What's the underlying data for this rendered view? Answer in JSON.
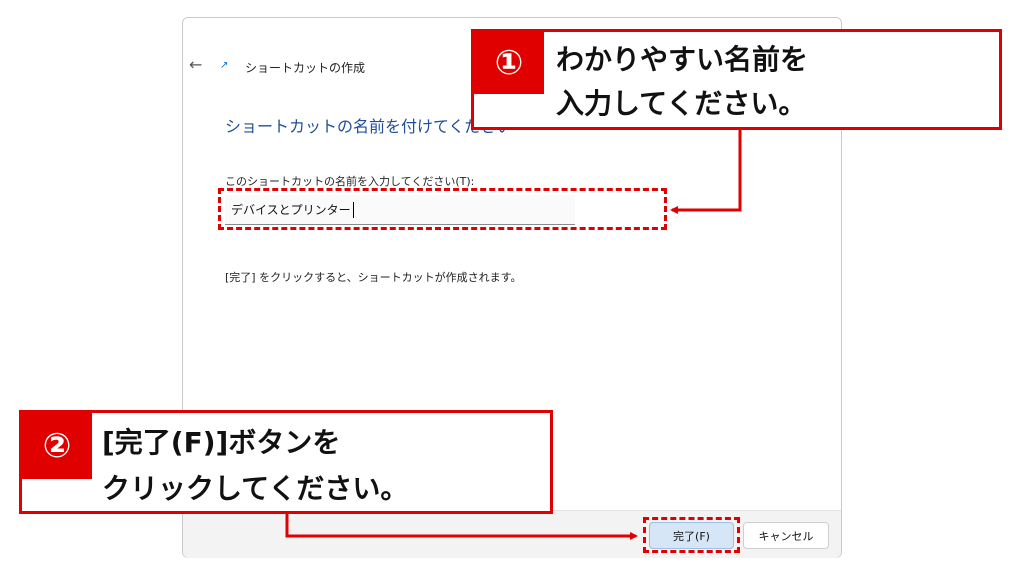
{
  "wizard": {
    "back_icon": "back-arrow-icon",
    "shortcut_icon": "shortcut-arrow-icon",
    "title": "ショートカットの作成",
    "heading": "ショートカットの名前を付けてください",
    "field_label": "このショートカットの名前を入力してください(T):",
    "input_value": "デバイスとプリンター",
    "hint": "[完了] をクリックすると、ショートカットが作成されます。",
    "finish_label": "完了(F)",
    "cancel_label": "キャンセル"
  },
  "callouts": [
    {
      "number": "①",
      "line1": "わかりやすい名前を",
      "line2": "入力してください。"
    },
    {
      "number": "②",
      "line1": "[完了(F)]ボタンを",
      "line2": "クリックしてください。"
    }
  ],
  "colors": {
    "highlight": "#e00000",
    "heading": "#1f4e9c",
    "finish_button": "#d6e6f6"
  }
}
